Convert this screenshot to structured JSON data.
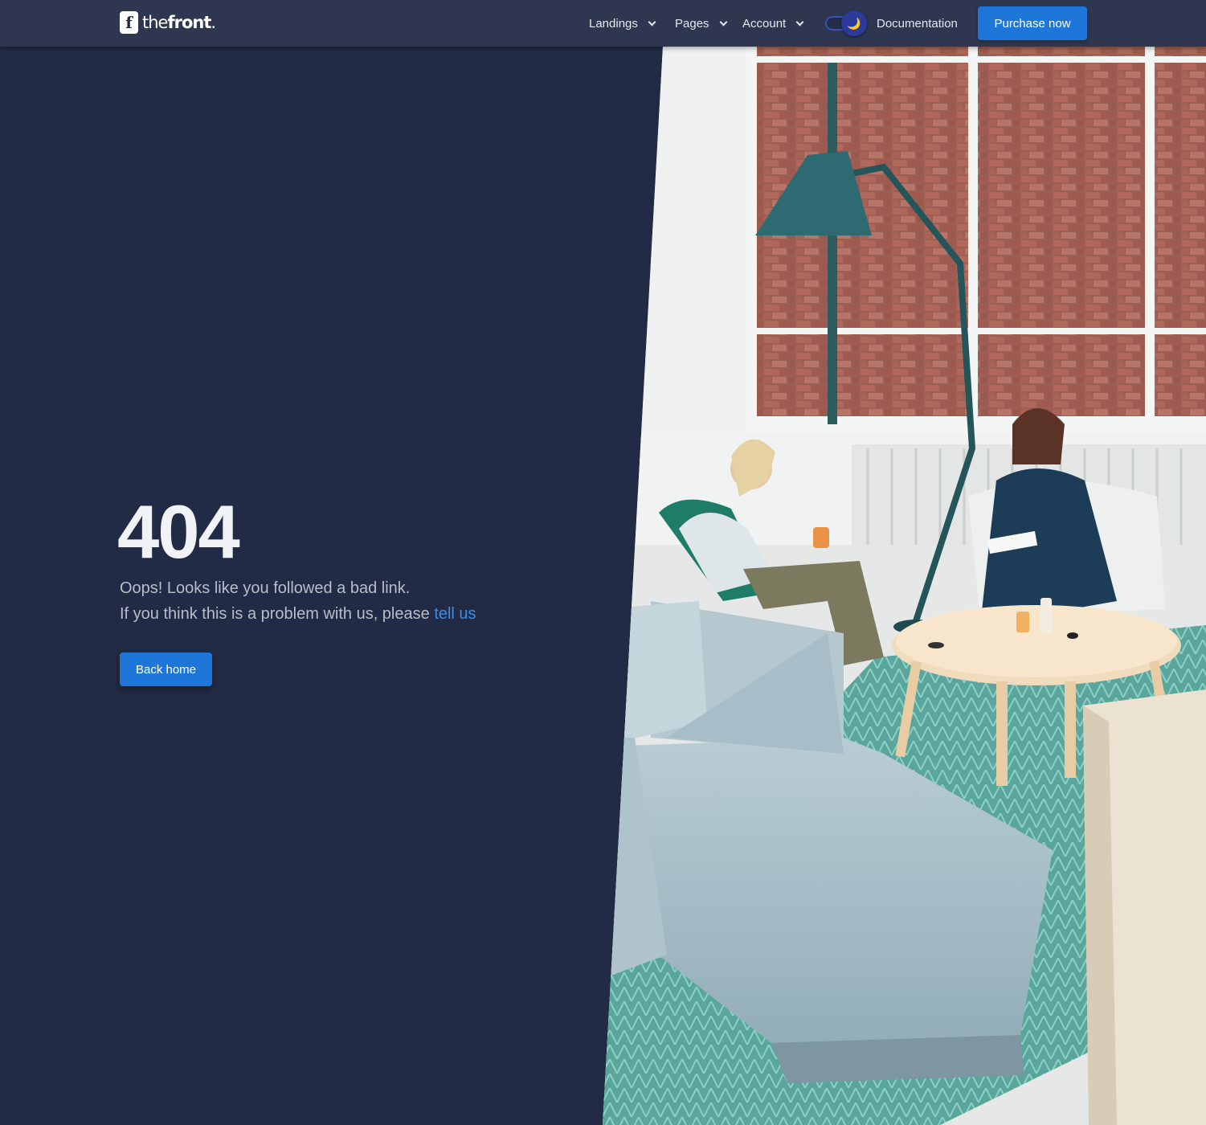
{
  "header": {
    "logo": {
      "mark": "f",
      "text_light": "the",
      "text_bold": "front",
      "dot": "."
    },
    "nav": [
      {
        "label": "Landings",
        "has_dropdown": true
      },
      {
        "label": "Pages",
        "has_dropdown": true
      },
      {
        "label": "Account",
        "has_dropdown": true
      }
    ],
    "theme_toggle": {
      "mode": "dark",
      "icon": "moon-icon",
      "glyph": "🌙"
    },
    "documentation_label": "Documentation",
    "purchase_label": "Purchase now"
  },
  "error": {
    "code": "404",
    "message": "Oops! Looks like you followed a bad link.",
    "help_prefix": "If you think this is a problem with us, please",
    "help_link": "tell us",
    "back_label": "Back home"
  },
  "theme": {
    "background": "#222b45",
    "header_background": "#2e3650",
    "accent": "#1e77d8",
    "link": "#3a8ee6",
    "text_primary": "#f1f2f5",
    "text_secondary": "#b9bdc9"
  },
  "hero_image": {
    "icon": "office-lounge-photo"
  }
}
